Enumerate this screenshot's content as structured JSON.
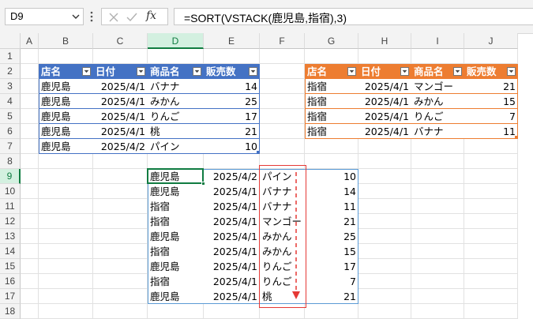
{
  "name_box": "D9",
  "formula": "=SORT(VSTACK(鹿児島,指宿),3)",
  "fx_label": "fx",
  "columns": [
    "A",
    "B",
    "C",
    "D",
    "E",
    "F",
    "G",
    "H",
    "I",
    "J"
  ],
  "rows": [
    "1",
    "2",
    "3",
    "4",
    "5",
    "6",
    "7",
    "8",
    "9",
    "10",
    "11",
    "12",
    "13",
    "14",
    "15",
    "16",
    "17",
    "18"
  ],
  "table1": {
    "headers": [
      "店名",
      "日付",
      "商品名",
      "販売数"
    ],
    "rows": [
      [
        "鹿児島",
        "2025/4/1",
        "バナナ",
        "14"
      ],
      [
        "鹿児島",
        "2025/4/1",
        "みかん",
        "25"
      ],
      [
        "鹿児島",
        "2025/4/1",
        "りんご",
        "17"
      ],
      [
        "鹿児島",
        "2025/4/1",
        "桃",
        "21"
      ],
      [
        "鹿児島",
        "2025/4/2",
        "パイン",
        "10"
      ]
    ],
    "header_color": "#4472c4"
  },
  "table2": {
    "headers": [
      "店名",
      "日付",
      "商品名",
      "販売数"
    ],
    "rows": [
      [
        "指宿",
        "2025/4/1",
        "マンゴー",
        "21"
      ],
      [
        "指宿",
        "2025/4/1",
        "みかん",
        "15"
      ],
      [
        "指宿",
        "2025/4/1",
        "りんご",
        "7"
      ],
      [
        "指宿",
        "2025/4/1",
        "バナナ",
        "11"
      ]
    ],
    "header_color": "#ed7d31"
  },
  "result": {
    "rows": [
      [
        "鹿児島",
        "2025/4/2",
        "パイン",
        "10"
      ],
      [
        "鹿児島",
        "2025/4/1",
        "バナナ",
        "14"
      ],
      [
        "指宿",
        "2025/4/1",
        "バナナ",
        "11"
      ],
      [
        "指宿",
        "2025/4/1",
        "マンゴー",
        "21"
      ],
      [
        "鹿児島",
        "2025/4/1",
        "みかん",
        "25"
      ],
      [
        "指宿",
        "2025/4/1",
        "みかん",
        "15"
      ],
      [
        "鹿児島",
        "2025/4/1",
        "りんご",
        "17"
      ],
      [
        "指宿",
        "2025/4/1",
        "りんご",
        "7"
      ],
      [
        "鹿児島",
        "2025/4/1",
        "桃",
        "21"
      ]
    ]
  },
  "colors": {
    "selection": "#107c41",
    "highlight_box": "#e53935",
    "spill_border": "#5b9bd5"
  }
}
